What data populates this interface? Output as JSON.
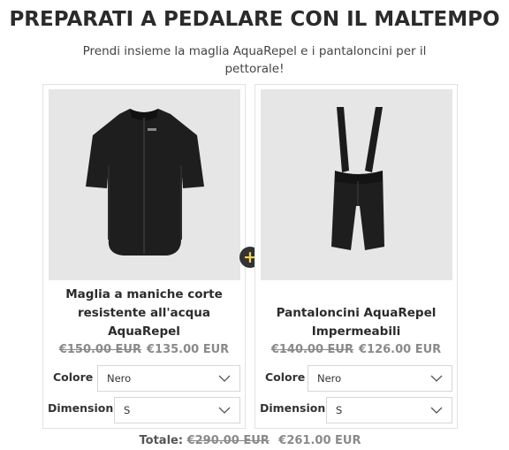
{
  "header": {
    "title": "PREPARATI A PEDALARE CON IL MALTEMPO",
    "subtitle": "Prendi insieme la maglia AquaRepel e i pantaloncini per il pettorale!"
  },
  "products": [
    {
      "name": "Maglia a maniche corte resistente all'acqua AquaRepel",
      "old_price": "€150.00 EUR",
      "new_price": "€135.00 EUR",
      "color_label": "Colore",
      "color_value": "Nero",
      "size_label": "Dimensioni",
      "size_value": "S"
    },
    {
      "name": "Pantaloncini AquaRepel Impermeabili",
      "old_price": "€140.00 EUR",
      "new_price": "€126.00 EUR",
      "color_label": "Colore",
      "color_value": "Nero",
      "size_label": "Dimensioni",
      "size_value": "S"
    }
  ],
  "plus_symbol": "+",
  "total": {
    "label": "Totale:",
    "old_price": "€290.00 EUR",
    "new_price": "€261.00 EUR"
  },
  "colors": {
    "accent": "#f5d25a",
    "dark": "#333333",
    "strike": "#8a8a8a"
  }
}
